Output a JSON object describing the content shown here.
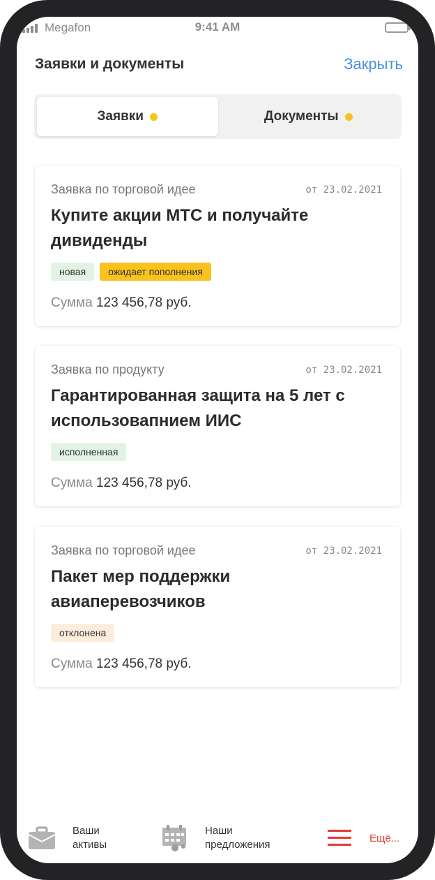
{
  "status_bar": {
    "carrier": "Megafon",
    "time": "9:41 AM"
  },
  "header": {
    "title": "Заявки и документы",
    "close_label": "Закрыть"
  },
  "tabs": [
    {
      "label": "Заявки",
      "active": true
    },
    {
      "label": "Документы",
      "active": false
    }
  ],
  "cards": [
    {
      "type": "Заявка по торговой идее",
      "date": "от 23.02.2021",
      "title": "Купите акции МТС и получайте дивиденды",
      "badges": [
        "новая",
        "ожидает пополнения"
      ],
      "sum_label": "Сумма",
      "sum_value": "123 456,78 руб."
    },
    {
      "type": "Заявка по продукту",
      "date": "от 23.02.2021",
      "title": "Гарантированная защита на 5 лет с использовапнием ИИС",
      "badges": [
        "исполненная"
      ],
      "sum_label": "Сумма",
      "sum_value": "123 456,78 руб."
    },
    {
      "type": "Заявка по торговой идее",
      "date": "от 23.02.2021",
      "title": "Пакет мер поддержки авиаперевозчиков",
      "badges": [
        "отклонена"
      ],
      "sum_label": "Сумма",
      "sum_value": "123 456,78 руб."
    }
  ],
  "bottom_nav": {
    "assets": {
      "line1": "Ваши",
      "line2": "активы",
      "icon": "briefcase-icon"
    },
    "offers": {
      "line1": "Наши",
      "line2": "предложения",
      "icon": "calendar-icon"
    },
    "more": {
      "label": "Ещё...",
      "icon": "menu-icon"
    }
  },
  "colors": {
    "accent": "#4a90e2",
    "tab_dot": "#f5c518",
    "badge_new": "#e3f3e3",
    "badge_pending": "#f9c21e",
    "badge_rejected": "#fdeedb",
    "more": "#e53935"
  }
}
